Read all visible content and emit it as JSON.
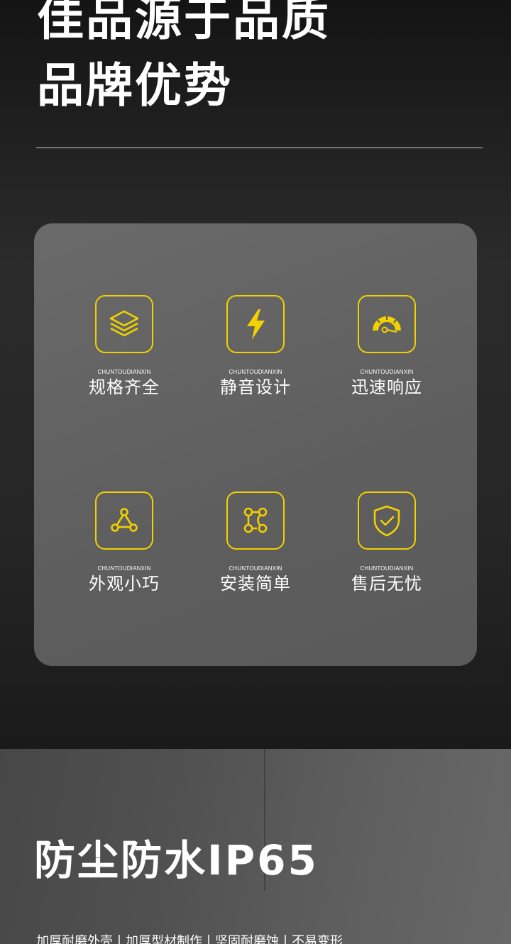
{
  "hero": {
    "title_line1": "佳品源于品质",
    "title_line2": "品牌优势"
  },
  "features": [
    {
      "icon": "layers-icon",
      "sub": "CHUNTOUDIANXIN",
      "label": "规格齐全"
    },
    {
      "icon": "lightning-icon",
      "sub": "CHUNTOUDIANXIN",
      "label": "静音设计"
    },
    {
      "icon": "speedometer-icon",
      "sub": "CHUNTOUDIANXIN",
      "label": "迅速响应"
    },
    {
      "icon": "triangle-nodes-icon",
      "sub": "CHUNTOUDIANXIN",
      "label": "外观小巧"
    },
    {
      "icon": "flow-nodes-icon",
      "sub": "CHUNTOUDIANXIN",
      "label": "安装简单"
    },
    {
      "icon": "shield-check-icon",
      "sub": "CHUNTOUDIANXIN",
      "label": "售后无忧"
    }
  ],
  "protection": {
    "title": "防尘防水IP65",
    "description": "加厚耐磨外壳丨加厚型材制作丨坚固耐磨蚀丨不易变形"
  },
  "colors": {
    "accent": "#f2d100",
    "panel": "#616161",
    "text": "#ffffff"
  }
}
